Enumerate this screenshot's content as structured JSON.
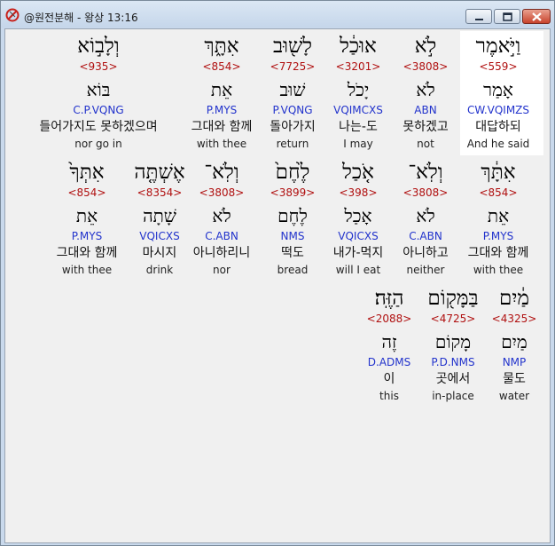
{
  "window": {
    "title": "@원전분해 - 왕상 13:16"
  },
  "rows": [
    [
      {
        "heb": "וַיֹּ֣אמֶר",
        "strong": "<559>",
        "lemma": "אָמַר",
        "parse": "CW.VQIMZS",
        "kor": "대답하되",
        "eng": "And he said",
        "selected": true
      },
      {
        "heb": "לֹ֣א",
        "strong": "<3808>",
        "lemma": "לֹא",
        "parse": "ABN",
        "kor": "못하겠고",
        "eng": "not"
      },
      {
        "heb": "אוּכַ֔ל",
        "strong": "<3201>",
        "lemma": "יָכֹל",
        "parse": "VQIMCXS",
        "kor": "나는-도",
        "eng": "I may"
      },
      {
        "heb": "לָשׁ֖וּב",
        "strong": "<7725>",
        "lemma": "שׁוּב",
        "parse": "P.VQNG",
        "kor": "돌아가지",
        "eng": "return"
      },
      {
        "heb": "אִתָּ֑ךְ",
        "strong": "<854>",
        "lemma": "אֵת",
        "parse": "P.MYS",
        "kor": "그대와 함께",
        "eng": "with thee"
      },
      {
        "heb": "וְלָב֣וֹא",
        "strong": "<935>",
        "lemma": "בּוֹא",
        "parse": "C.P.VQNG",
        "kor": "들어가지도 못하겠으며",
        "eng": "nor go in"
      }
    ],
    [
      {
        "heb": "אִתָּ֔ךְ",
        "strong": "<854>",
        "lemma": "אֵת",
        "parse": "P.MYS",
        "kor": "그대와 함께",
        "eng": "with thee"
      },
      {
        "heb": "וְלֹֽא־",
        "strong": "<3808>",
        "lemma": "לֹא",
        "parse": "C.ABN",
        "kor": "아니하고",
        "eng": "neither"
      },
      {
        "heb": "אֹ֤כַל",
        "strong": "<398>",
        "lemma": "אָכַל",
        "parse": "VQICXS",
        "kor": "내가-먹지",
        "eng": "will I eat"
      },
      {
        "heb": "לֶ֙חֶם֙",
        "strong": "<3899>",
        "lemma": "לֶחֶם",
        "parse": "NMS",
        "kor": "떡도",
        "eng": "bread"
      },
      {
        "heb": "וְלֹֽא־",
        "strong": "<3808>",
        "lemma": "לֹא",
        "parse": "C.ABN",
        "kor": "아니하리니",
        "eng": "nor"
      },
      {
        "heb": "אֶשְׁתֶּ֤ה",
        "strong": "<8354>",
        "lemma": "שָׁתָה",
        "parse": "VQICXS",
        "kor": "마시지",
        "eng": "drink"
      },
      {
        "heb": "אִתְּךָ֙",
        "strong": "<854>",
        "lemma": "אֵת",
        "parse": "P.MYS",
        "kor": "그대와 함께",
        "eng": "with thee"
      }
    ],
    [
      {
        "heb": "מַ֔יִם",
        "strong": "<4325>",
        "lemma": "מַיִם",
        "parse": "NMP",
        "kor": "물도",
        "eng": "water"
      },
      {
        "heb": "בַּמָּק֖וֹם",
        "strong": "<4725>",
        "lemma": "מָקוֹם",
        "parse": "P.D.NMS",
        "kor": "곳에서",
        "eng": "in-place"
      },
      {
        "heb": "הַזֶּֽה׃",
        "strong": "<2088>",
        "lemma": "זֶה",
        "parse": "D.ADMS",
        "kor": "이",
        "eng": "this"
      }
    ]
  ]
}
